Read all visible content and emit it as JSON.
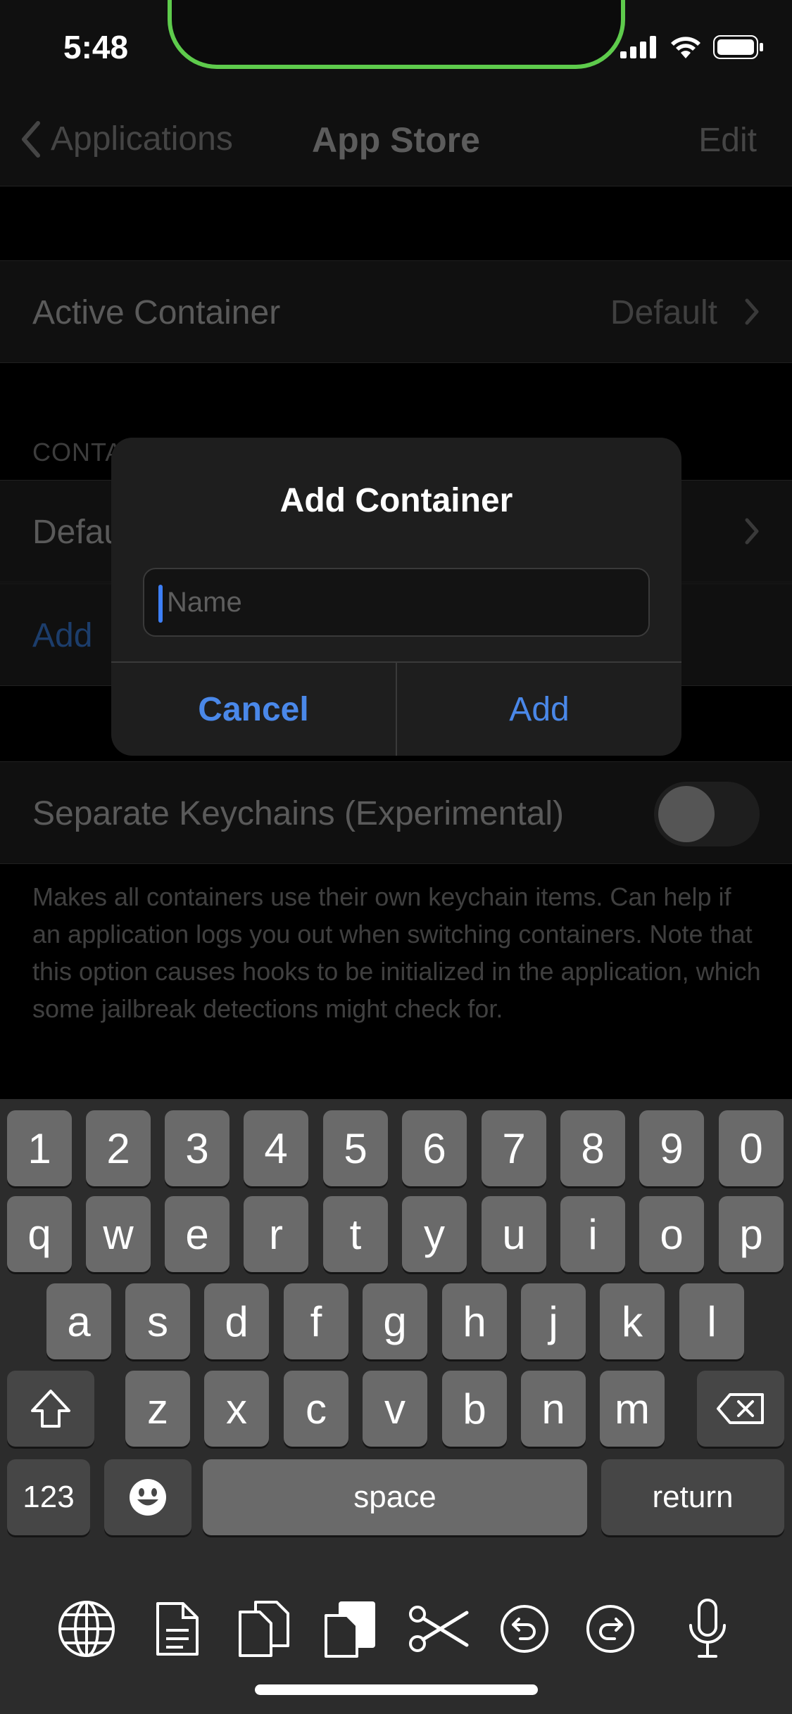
{
  "status_bar": {
    "time": "5:48"
  },
  "nav": {
    "back_label": "Applications",
    "title": "App Store",
    "edit_label": "Edit"
  },
  "active_container": {
    "label": "Active Container",
    "value": "Default"
  },
  "containers_section": {
    "header": "CONTAINERS",
    "default_label": "Default",
    "add_label": "Add"
  },
  "separate_keychains": {
    "label": "Separate Keychains (Experimental)",
    "enabled": false
  },
  "footer_note": "Makes all containers use their own keychain items. Can help if an application logs you out when switching containers. Note that this option causes hooks to be initialized in the application, which some jailbreak detections might check for.",
  "alert": {
    "title": "Add Container",
    "input_placeholder": "Name",
    "input_value": "",
    "cancel_label": "Cancel",
    "add_label": "Add"
  },
  "keyboard": {
    "row_numbers": [
      "1",
      "2",
      "3",
      "4",
      "5",
      "6",
      "7",
      "8",
      "9",
      "0"
    ],
    "row_top": [
      "q",
      "w",
      "e",
      "r",
      "t",
      "y",
      "u",
      "i",
      "o",
      "p"
    ],
    "row_middle": [
      "a",
      "s",
      "d",
      "f",
      "g",
      "h",
      "j",
      "k",
      "l"
    ],
    "row_bottom": [
      "z",
      "x",
      "c",
      "v",
      "b",
      "n",
      "m"
    ],
    "mode_label": "123",
    "space_label": "space",
    "return_label": "return"
  },
  "toolbar_icons": [
    "globe-icon",
    "document-icon",
    "copy-icon",
    "paste-icon",
    "scissors-icon",
    "undo-icon",
    "redo-icon",
    "microphone-icon"
  ]
}
